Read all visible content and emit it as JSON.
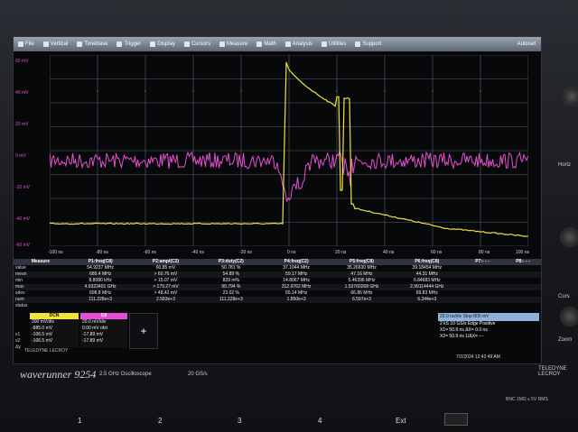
{
  "menu": {
    "items": [
      {
        "label": "File",
        "icon": "file-icon"
      },
      {
        "label": "Vertical",
        "icon": "vertical-icon"
      },
      {
        "label": "Timebase",
        "icon": "timebase-icon"
      },
      {
        "label": "Trigger",
        "icon": "trigger-icon"
      },
      {
        "label": "Display",
        "icon": "display-icon"
      },
      {
        "label": "Cursors",
        "icon": "cursors-icon"
      },
      {
        "label": "Measure",
        "icon": "measure-icon"
      },
      {
        "label": "Math",
        "icon": "math-icon"
      },
      {
        "label": "Analysis",
        "icon": "analysis-icon"
      },
      {
        "label": "Utilities",
        "icon": "utilities-icon"
      },
      {
        "label": "Support",
        "icon": "support-icon"
      }
    ],
    "autoset": "Autoset"
  },
  "y_labels": [
    "60 mV",
    "40 mV",
    "20 mV",
    "0 mV",
    "-20 mV",
    "-40 mV",
    "-60 mV"
  ],
  "x_labels": [
    "-100 ns",
    "-80 ns",
    "-60 ns",
    "-40 ns",
    "-20 ns",
    "0 ns",
    "20 ns",
    "40 ns",
    "60 ns",
    "80 ns",
    "100 ns"
  ],
  "measure": {
    "headers": [
      "Measure",
      "P1:freq(C8)",
      "P2:ampl(C2)",
      "P3:duty(C2)",
      "P4:freq(C2)",
      "P5:freq(C8)",
      "P6:freq(C8)",
      "P7:- - -",
      "P8:- - -"
    ],
    "rows": [
      [
        "value",
        "54.9237 MHz",
        "60.85 mV",
        "50.781 %",
        "37.1044 MHz",
        "35.26630 MHz",
        "39.18454 MHz",
        "",
        ""
      ],
      [
        "mean",
        "689.4 MHz",
        "> 60.76 mV",
        "54.89 %",
        "59.17 MHz",
        "47.16 MHz",
        "44.31 MHz",
        "",
        ""
      ],
      [
        "min",
        "8.8080 kHz",
        "> 15.07 mV",
        "839 m%",
        "14.8067 MHz",
        "5.46396 MHz",
        "6.84683 MHz",
        "",
        ""
      ],
      [
        "max",
        "4.9323401 GHz",
        "> 179.27 mV",
        "99.794 %",
        "312.9762 MHz",
        "1.53760268 GHz",
        "2.99114444 GHz",
        "",
        ""
      ],
      [
        "sdev",
        "698.8 MHz",
        "> 48.42 mV",
        "23.02 %",
        "65.14 MHz",
        "66.86 MHz",
        "69.83 MHz",
        "",
        ""
      ],
      [
        "num",
        "111.228e+3",
        "2.583e+3",
        "111.228e+3",
        "1.850e+3",
        "6.597e+3",
        "6.344e+3",
        "",
        ""
      ],
      [
        "status",
        "",
        "",
        "",
        "",
        "",
        "",
        "",
        ""
      ]
    ]
  },
  "descriptors": [
    {
      "tag": "DCN",
      "color": "#f2e13a",
      "rows": [
        "200 mV/div",
        "-885.0 mV",
        "-106.5 mV",
        "-106.5 mV",
        "0.0 mV"
      ]
    },
    {
      "tag": "C8",
      "color": "#e64fd3",
      "rows": [
        "20.0 mV/div",
        "0.00 mV ofst",
        "-17.89 mV",
        "-17.89 mV",
        "0.0 mV"
      ]
    }
  ],
  "descriptor_labels": [
    "x1",
    "x2",
    "Δy"
  ],
  "add_button": "+",
  "footer_brand": "TELEDYNE LECROY",
  "timebase": {
    "top_left": "",
    "top_right": "20.0 ns/div  Stop  800 mV",
    "row2": "2 kS   10 GS/s  Edge  Positive",
    "cursor1": "X1= 50.9 ns  ΔX= 0.0 ns",
    "cursor2": "X2= 50.9 ns  1/ΔX= ---"
  },
  "datetime": "7/2/2024 12:42:49 AM",
  "brand": "waverunner 9254",
  "spec1": "2.5 GHz Oscilloscope",
  "spec2": "20 GS/s",
  "bottom_buttons": [
    "1",
    "2",
    "3",
    "4",
    "Ext"
  ],
  "side_labels": [
    "Horiz",
    "Curs",
    "Zoom"
  ],
  "bnc": "BNC  1MΩ ≤ 5V RMS",
  "tele": "TELEDYNE LECROY",
  "colors": {
    "c1": "#f2e13a",
    "c8": "#e64fd3",
    "grid": "#5a5f68"
  }
}
